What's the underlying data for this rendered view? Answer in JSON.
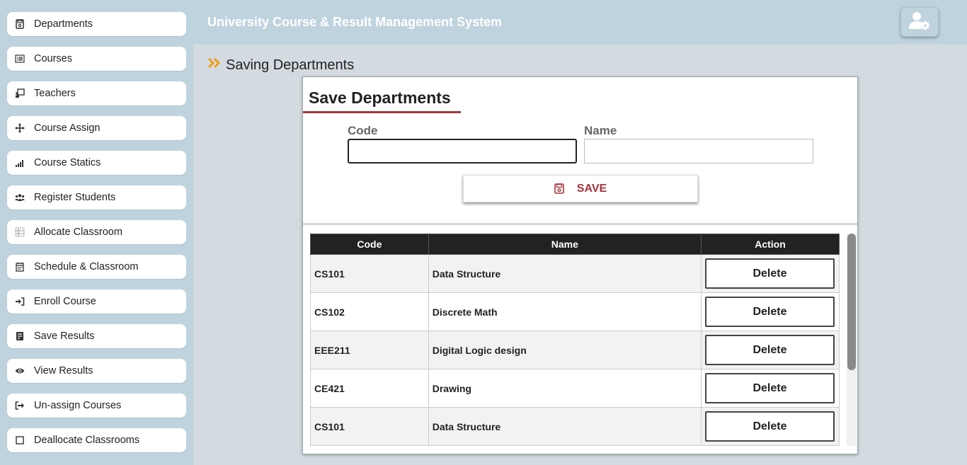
{
  "app": {
    "title": "University Course & Result Management System"
  },
  "sidebar": {
    "items": [
      {
        "label": "Departments",
        "icon": "save-file-icon"
      },
      {
        "label": "Courses",
        "icon": "list-icon"
      },
      {
        "label": "Teachers",
        "icon": "teacher-board-icon"
      },
      {
        "label": "Course Assign",
        "icon": "move-arrows-icon"
      },
      {
        "label": "Course Statics",
        "icon": "signal-bars-icon"
      },
      {
        "label": "Register Students",
        "icon": "users-icon"
      },
      {
        "label": "Allocate Classroom",
        "icon": "grid-icon"
      },
      {
        "label": "Schedule & Classroom",
        "icon": "calendar-icon"
      },
      {
        "label": "Enroll Course",
        "icon": "sign-in-icon"
      },
      {
        "label": "Save Results",
        "icon": "document-icon"
      },
      {
        "label": "View Results",
        "icon": "eye-icon"
      },
      {
        "label": "Un-assign Courses",
        "icon": "sign-out-icon"
      },
      {
        "label": "Deallocate Classrooms",
        "icon": "square-icon"
      }
    ]
  },
  "page": {
    "title": "Saving Departments"
  },
  "form": {
    "title": "Save Departments",
    "code_label": "Code",
    "code_value": "",
    "name_label": "Name",
    "name_value": "",
    "save_label": "SAVE"
  },
  "table": {
    "headers": [
      "Code",
      "Name",
      "Action"
    ],
    "rows": [
      {
        "code": "CS101",
        "name": "Data Structure",
        "action": "Delete"
      },
      {
        "code": "CS102",
        "name": "Discrete Math",
        "action": "Delete"
      },
      {
        "code": "EEE211",
        "name": "Digital Logic design",
        "action": "Delete"
      },
      {
        "code": "CE421",
        "name": "Drawing",
        "action": "Delete"
      },
      {
        "code": "CS101",
        "name": "Data Structure",
        "action": "Delete"
      }
    ]
  },
  "colors": {
    "accent": "#a6343c",
    "chevron": "#f39c12",
    "sidebar_bg": "#bfd3df",
    "table_header": "#222222"
  }
}
